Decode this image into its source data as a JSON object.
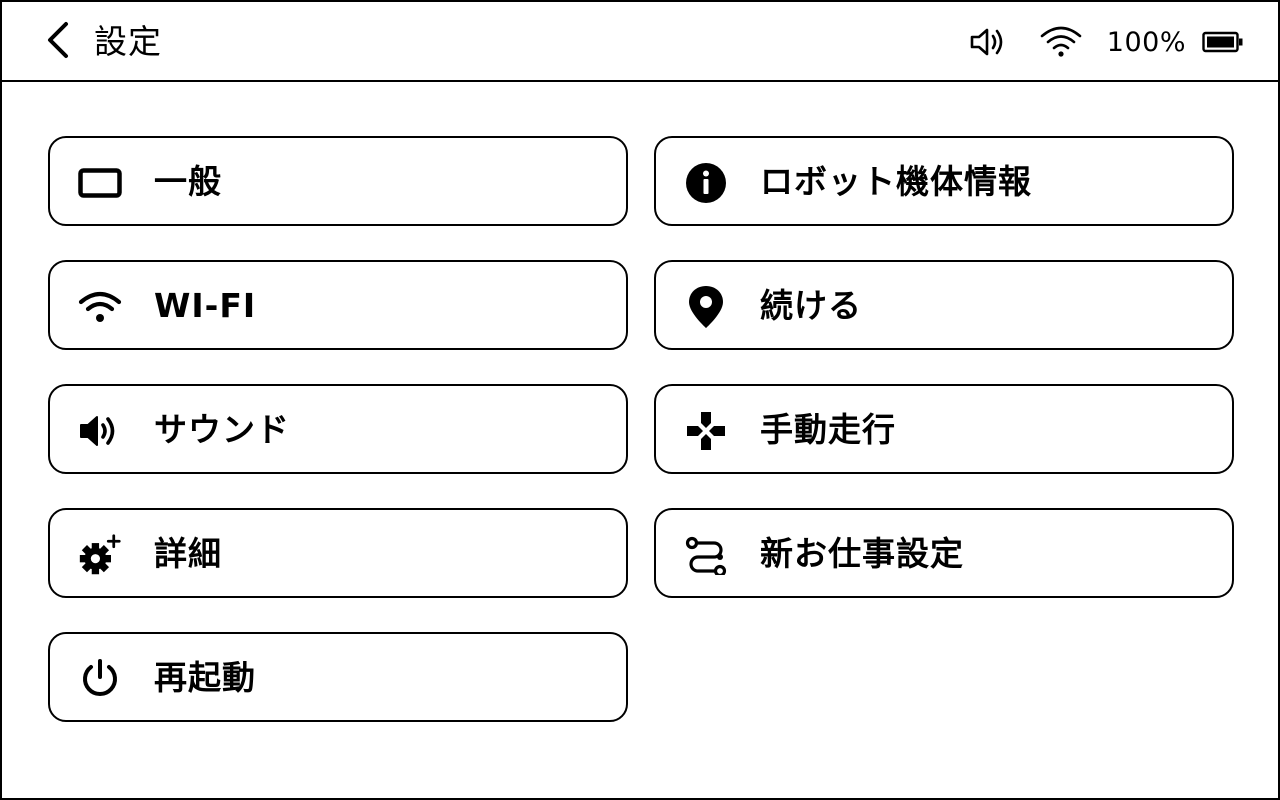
{
  "header": {
    "title": "設定",
    "battery_text": "100%",
    "icons": {
      "back": "chevron-left-icon",
      "volume": "volume-icon",
      "wifi": "wifi-icon",
      "battery": "battery-icon"
    }
  },
  "menu": {
    "left": [
      {
        "label": "一般",
        "icon": "rectangle-icon"
      },
      {
        "label": "WI-FI",
        "icon": "wifi-icon"
      },
      {
        "label": "サウンド",
        "icon": "speaker-icon"
      },
      {
        "label": "詳細",
        "icon": "gear-plus-icon"
      },
      {
        "label": "再起動",
        "icon": "power-icon"
      }
    ],
    "right": [
      {
        "label": "ロボット機体情報",
        "icon": "info-icon"
      },
      {
        "label": "続ける",
        "icon": "location-pin-icon"
      },
      {
        "label": "手動走行",
        "icon": "dpad-icon"
      },
      {
        "label": "新お仕事設定",
        "icon": "route-icon"
      }
    ]
  },
  "colors": {
    "foreground": "#000000",
    "background": "#ffffff"
  }
}
